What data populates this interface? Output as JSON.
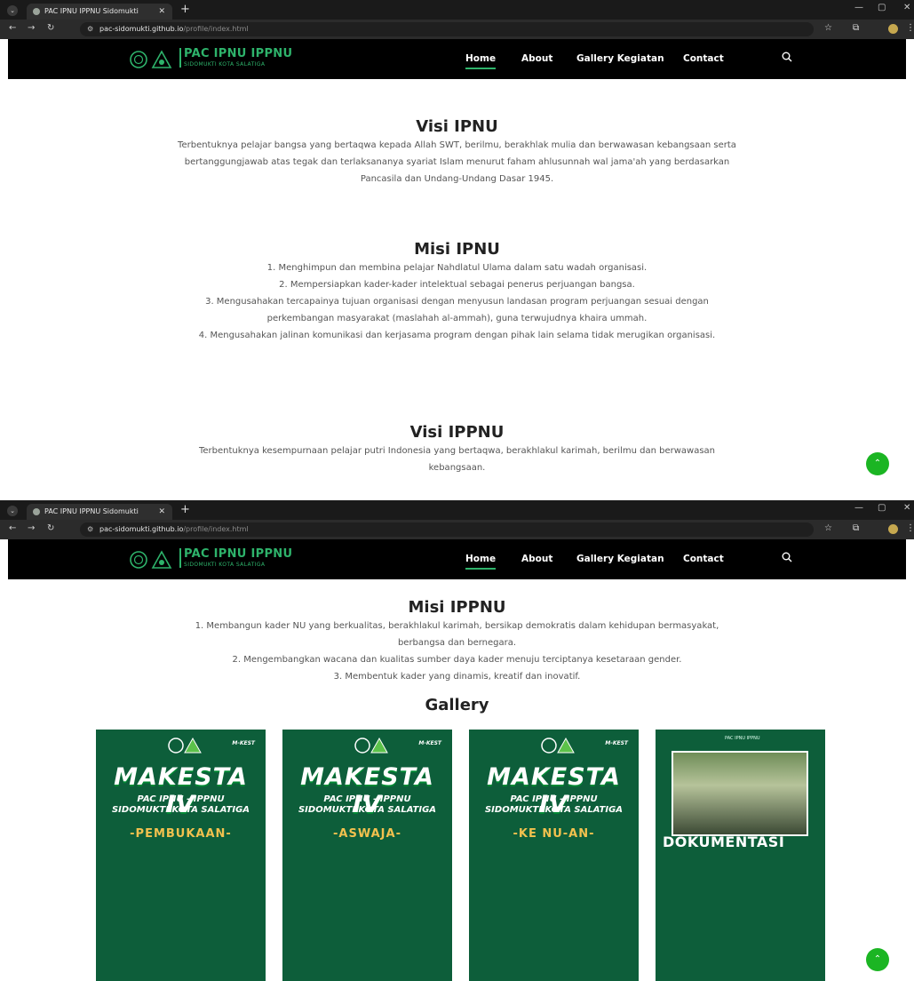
{
  "browser": {
    "tab_title": "PAC IPNU IPPNU Sidomukti",
    "url_host": "pac-sidomukti.github.io",
    "url_path": "/profile/index.html"
  },
  "site": {
    "logo_title": "PAC IPNU IPPNU",
    "logo_subtitle": "SIDOMUKTI KOTA SALATIGA",
    "nav": [
      "Home",
      "About",
      "Gallery Kegiatan",
      "Contact"
    ]
  },
  "sections": {
    "visi_ipnu": {
      "title": "Visi IPNU",
      "text": "Terbentuknya pelajar bangsa yang bertaqwa kepada Allah SWT, berilmu, berakhlak mulia dan berwawasan kebangsaan serta bertanggungjawab atas tegak dan terlaksananya syariat Islam menurut faham ahlusunnah wal jama'ah yang berdasarkan Pancasila dan Undang-Undang Dasar 1945."
    },
    "misi_ipnu": {
      "title": "Misi IPNU",
      "items": [
        "1. Menghimpun dan membina pelajar Nahdlatul Ulama dalam satu wadah organisasi.",
        "2. Mempersiapkan kader-kader intelektual sebagai penerus perjuangan bangsa.",
        "3. Mengusahakan tercapainya tujuan organisasi dengan menyusun landasan program perjuangan sesuai dengan perkembangan masyarakat (maslahah al-ammah), guna terwujudnya khaira ummah.",
        "4. Mengusahakan jalinan komunikasi dan kerjasama program dengan pihak lain selama tidak merugikan organisasi."
      ]
    },
    "visi_ippnu": {
      "title": "Visi IPPNU",
      "text": "Terbentuknya kesempurnaan pelajar putri Indonesia yang bertaqwa, berakhlakul karimah, berilmu dan berwawasan kebangsaan."
    },
    "misi_ippnu": {
      "title": "Misi IPPNU",
      "items": [
        "1. Membangun kader NU yang berkualitas, berakhlakul karimah, bersikap demokratis dalam kehidupan bermasyakat, berbangsa dan bernegara.",
        "2. Mengembangkan wacana dan kualitas sumber daya kader menuju terciptanya kesetaraan gender.",
        "3. Membentuk kader yang dinamis, kreatif dan inovatif."
      ]
    }
  },
  "gallery": {
    "title": "Gallery",
    "cards": [
      {
        "brand": "M-KEST",
        "headline": "MAKESTA IV",
        "line2": "PAC IPNU - IPPNU",
        "line3": "SIDOMUKTI KOTA SALATIGA",
        "event": "-PEMBUKAAN-"
      },
      {
        "brand": "M-KEST",
        "headline": "MAKESTA IV",
        "line2": "PAC IPNU - IPPNU",
        "line3": "SIDOMUKTI KOTA SALATIGA",
        "event": "-ASWAJA-"
      },
      {
        "brand": "M-KEST",
        "headline": "MAKESTA IV",
        "line2": "PAC IPNU - IPPNU",
        "line3": "SIDOMUKTI KOTA SALATIGA",
        "event": "-KE NU-AN-"
      },
      {
        "header": "PAC IPNU IPPNU",
        "label": "DOKUMENTASI"
      }
    ]
  },
  "colors": {
    "accent": "#2eb36b",
    "scroll_button": "#1bb523",
    "card_bg": "#0d5e3a"
  }
}
